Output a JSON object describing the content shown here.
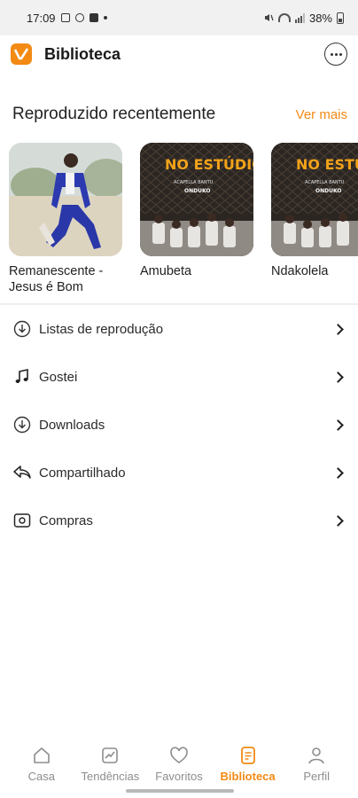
{
  "status_bar": {
    "time": "17:09",
    "battery": "38%",
    "icons": [
      "gallery-icon",
      "sync-icon",
      "youtube-icon",
      "dot-icon",
      "mute-icon",
      "wifi-icon",
      "signal-icon",
      "battery-icon"
    ]
  },
  "header": {
    "title": "Biblioteca",
    "logo_icon": "app-logo-icon",
    "chat_icon": "chat-icon"
  },
  "recent": {
    "title": "Reproduzido recentemente",
    "see_more": "Ver mais",
    "items": [
      {
        "label": "Remanescente  -\nJesus é Bom"
      },
      {
        "label": "Amubeta",
        "cover_text": "NO ESTÚDIO",
        "cover_subtitle": "ACAPELLA BANTU",
        "cover_artist": "ONDUKO"
      },
      {
        "label": "Ndakolela",
        "cover_text": "NO ESTÚDIO",
        "cover_subtitle": "ACAPELLA BANTU",
        "cover_artist": "ONDUKO"
      }
    ]
  },
  "menu": [
    {
      "label": "Listas de reprodução",
      "icon": "download-circle-icon"
    },
    {
      "label": "Gostei",
      "icon": "music-note-icon"
    },
    {
      "label": "Downloads",
      "icon": "download-circle-icon"
    },
    {
      "label": "Compartilhado",
      "icon": "share-arrow-icon"
    },
    {
      "label": "Compras",
      "icon": "purchase-icon"
    }
  ],
  "bottom_nav": [
    {
      "label": "Casa",
      "icon": "home-icon",
      "active": false
    },
    {
      "label": "Tendências",
      "icon": "trending-icon",
      "active": false
    },
    {
      "label": "Favoritos",
      "icon": "heart-icon",
      "active": false
    },
    {
      "label": "Biblioteca",
      "icon": "library-icon",
      "active": true
    },
    {
      "label": "Perfil",
      "icon": "profile-icon",
      "active": false
    }
  ],
  "colors": {
    "accent": "#f28a14",
    "text": "#1b1b1b",
    "inactive": "#8d8d8d"
  }
}
